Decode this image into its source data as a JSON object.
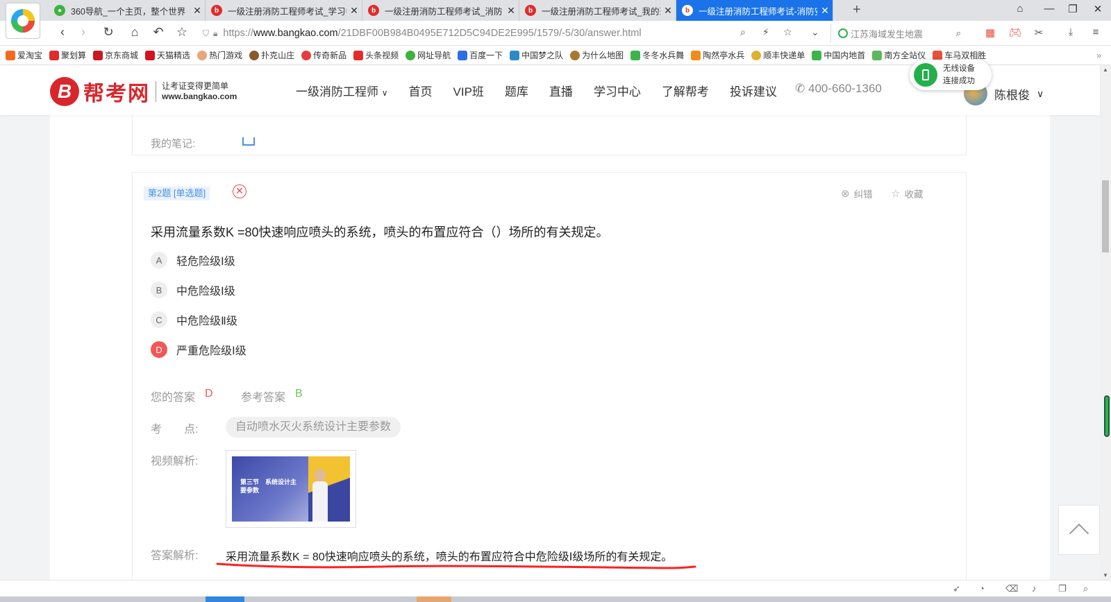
{
  "browser": {
    "tabs": [
      {
        "title": "360导航_一个主页，整个世界",
        "icon": "nav360"
      },
      {
        "title": "一级注册消防工程师考试_学习中",
        "icon": "bangkao"
      },
      {
        "title": "一级注册消防工程师考试_消防",
        "icon": "bangkao"
      },
      {
        "title": "一级注册消防工程师考试_我的班",
        "icon": "bangkao"
      },
      {
        "title": "一级注册消防工程师考试-消防安",
        "icon": "bangkao"
      }
    ],
    "url": {
      "prefix": "https://",
      "host": "www.bangkao.com",
      "path": "/21DBF00B984B0495E712D5C94DE2E995/1579/-5/30/answer.html"
    },
    "search_placeholder": "江苏海域发生地震",
    "bookmarks": [
      "爱淘宝",
      "聚划算",
      "京东商城",
      "天猫精选",
      "热门游戏",
      "扑克山庄",
      "传奇新品",
      "头条视频",
      "网址导航",
      "百度一下",
      "中国梦之队",
      "为什么地图",
      "冬冬水兵舞",
      "陶然亭水兵",
      "顺丰快递单",
      "中国内地首",
      "南方全站仪",
      "车马双相胜"
    ]
  },
  "site": {
    "logo": {
      "name": "帮考网",
      "slogan": "让考证变得更简单",
      "domain": "www.bangkao.com"
    },
    "nav": [
      "一级消防工程师",
      "首页",
      "VIP班",
      "题库",
      "直播",
      "学习中心",
      "了解帮考",
      "投诉建议"
    ],
    "phone": "400-660-1360",
    "user_name": "陈根俊",
    "toast": {
      "line1": "无线设备",
      "line2": "连接成功"
    }
  },
  "prev_card": {
    "note_label": "我的笔记:"
  },
  "question": {
    "tag": "第2题 [单选题]",
    "report_label": "纠错",
    "favorite_label": "收藏",
    "stem": "采用流量系数K =80快速响应喷头的系统，喷头的布置应符合（）场所的有关规定。",
    "options": [
      {
        "letter": "A",
        "text": "轻危险级Ⅰ级"
      },
      {
        "letter": "B",
        "text": "中危险级Ⅰ级"
      },
      {
        "letter": "C",
        "text": "中危险级Ⅱ级"
      },
      {
        "letter": "D",
        "text": "严重危险级Ⅰ级"
      }
    ],
    "selected": "D",
    "your_answer_label": "您的答案",
    "your_answer": "D",
    "ref_answer_label": "参考答案",
    "ref_answer": "B",
    "topic_label": "考　　点:",
    "topic": "自动喷水灭火系统设计主要参数",
    "video_label": "视频解析:",
    "video_thumb": {
      "line1": "第三节　系统设计主",
      "line2": "要参数"
    },
    "explain_label": "答案解析:",
    "explain": "采用流量系数K = 80快速响应喷头的系统，喷头的布置应符合中危险级Ⅰ级场所的有关规定。"
  },
  "colors": {
    "brand_red": "#d9262c",
    "wrong_red": "#f15757",
    "correct_green": "#6dc45a",
    "tag_blue": "#4a90e2"
  }
}
